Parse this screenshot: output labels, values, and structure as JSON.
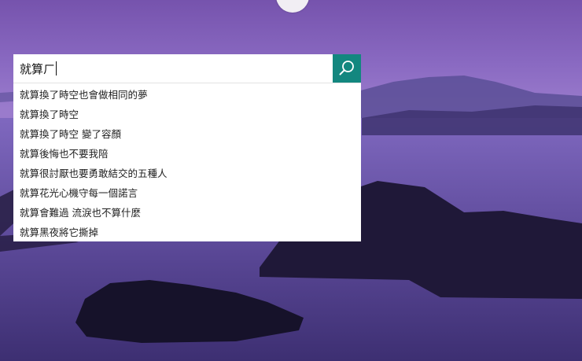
{
  "search": {
    "value": "就算ㄏ",
    "button_icon": "search-icon"
  },
  "suggestions": [
    {
      "label": "就算換了時空也會做相同的夢"
    },
    {
      "label": "就算換了時空"
    },
    {
      "label": "就算換了時空 變了容顏"
    },
    {
      "label": "就算後悔也不要我陪"
    },
    {
      "label": "就算很討厭也要勇敢結交的五種人"
    },
    {
      "label": "就算花光心機守每一個諾言"
    },
    {
      "label": "就算會難過 流淚也不算什麼"
    },
    {
      "label": "就算黑夜將它撕掉"
    }
  ],
  "colors": {
    "accent": "#13877f",
    "background_sky": "#8d6ec6",
    "background_water": "#4f3d86"
  }
}
